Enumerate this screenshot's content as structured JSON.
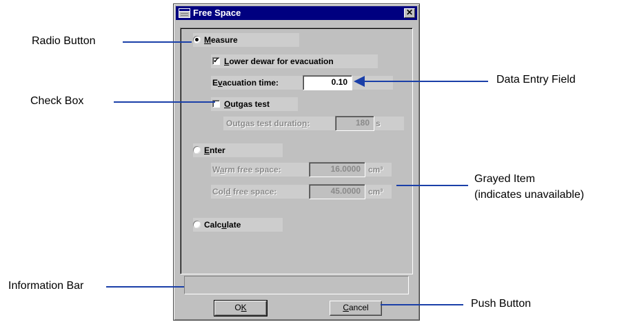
{
  "window": {
    "title": "Free Space",
    "close_glyph": "✕"
  },
  "measure": {
    "label_pre": "",
    "label_ul": "M",
    "label_post": "easure",
    "selected": true
  },
  "lower_dewar": {
    "label_pre": "",
    "label_ul": "L",
    "label_post": "ower dewar for evacuation",
    "checked": true
  },
  "evacuation_time": {
    "label_pre": "E",
    "label_ul": "v",
    "label_post": "acuation time:",
    "value": "0.10"
  },
  "outgas_test": {
    "label_pre": "",
    "label_ul": "O",
    "label_post": "utgas test",
    "checked": false
  },
  "outgas_duration": {
    "label_pre": "Outgas test duratio",
    "label_ul": "n",
    "label_post": ":",
    "value": "180",
    "unit": "s"
  },
  "enter": {
    "label_pre": "",
    "label_ul": "E",
    "label_post": "nter",
    "selected": false
  },
  "warm_free_space": {
    "label_pre": "W",
    "label_ul": "a",
    "label_post": "rm free space:",
    "value": "16.0000",
    "unit": "cm³"
  },
  "cold_free_space": {
    "label_pre": "Col",
    "label_ul": "d",
    "label_post": " free space:",
    "value": "45.0000",
    "unit": "cm³"
  },
  "calculate": {
    "label_pre": "Calc",
    "label_ul": "u",
    "label_post": "late",
    "selected": false
  },
  "info_bar": {
    "text": ""
  },
  "ok_button": {
    "label_pre": "O",
    "label_ul": "K",
    "label_post": ""
  },
  "cancel_button": {
    "label_pre": "",
    "label_ul": "C",
    "label_post": "ancel"
  },
  "callouts": {
    "radio_button": "Radio Button",
    "check_box": "Check Box",
    "information_bar": "Information Bar",
    "data_entry_field": "Data Entry Field",
    "grayed_item_line1": "Grayed Item",
    "grayed_item_line2": "(indicates unavailable)",
    "push_button": "Push Button"
  },
  "colors": {
    "titlebar": "#000080",
    "dialog": "#c0c0c0",
    "callout_line": "#1a3fa8"
  }
}
